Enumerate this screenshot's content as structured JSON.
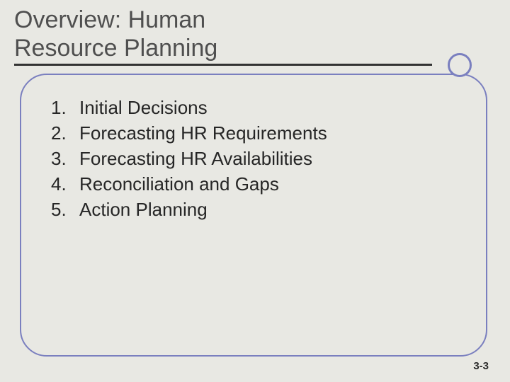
{
  "title": {
    "line1": "Overview:  Human",
    "line2": "Resource Planning"
  },
  "items": [
    {
      "num": "1.",
      "text": "Initial Decisions"
    },
    {
      "num": "2.",
      "text": "Forecasting HR Requirements"
    },
    {
      "num": "3.",
      "text": "Forecasting HR Availabilities"
    },
    {
      "num": "4.",
      "text": "Reconciliation and Gaps"
    },
    {
      "num": "5.",
      "text": "Action Planning"
    }
  ],
  "page_number": "3-3"
}
